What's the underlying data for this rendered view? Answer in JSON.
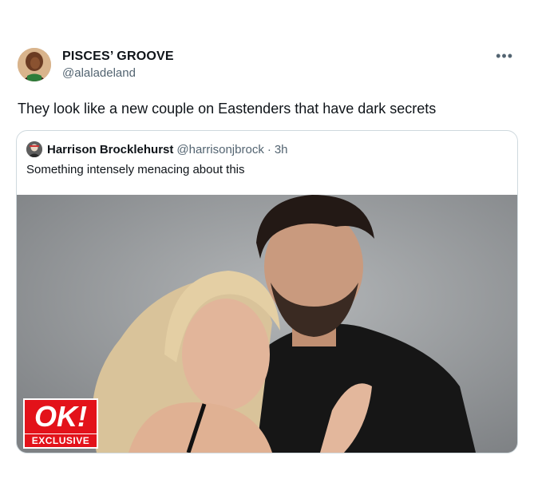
{
  "tweet": {
    "display_name": "PISCES’ GROOVE",
    "handle": "@alaladeland",
    "more_icon": "•••",
    "text": "They look like a new couple on Eastenders that have dark secrets"
  },
  "quoted_tweet": {
    "author_name": "Harrison Brocklehurst",
    "author_handle": "@harrisonjbrock",
    "separator": "·",
    "time": "3h",
    "text": "Something intensely menacing about this",
    "image": {
      "badge_title": "OK!",
      "badge_subtitle": "EXCLUSIVE"
    }
  }
}
